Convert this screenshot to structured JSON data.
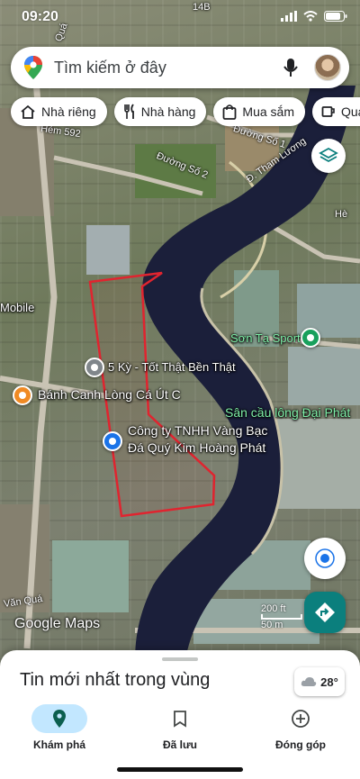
{
  "status_bar": {
    "time": "09:20"
  },
  "search": {
    "placeholder": "Tìm kiếm ở đây"
  },
  "chips": [
    {
      "label": "Nhà riêng",
      "icon": "home-icon"
    },
    {
      "label": "Nhà hàng",
      "icon": "restaurant-icon"
    },
    {
      "label": "Mua sắm",
      "icon": "shopping-bag-icon"
    },
    {
      "label": "Quá",
      "icon": "coffee-icon"
    }
  ],
  "map": {
    "streets": [
      "Hẻm 592",
      "Đường Số 1",
      "Đường Số 2",
      "Đ. Tham Lương",
      "Văn Quá",
      "Quá",
      "Hè",
      "14B"
    ],
    "places": {
      "mobile": "Mobile",
      "son_ta": "Sơn Tạ Sport",
      "ky_tot": "5 Kỳ - Tốt Thật Bền Thật",
      "san_cau_long": "Sân cầu lông Đại Phát",
      "banh_canh": "Bánh Canh Lòng Cá Út C",
      "cong_ty_line1": "Công ty TNHH Vàng Bạc",
      "cong_ty_line2": "Đá Quý Kim Hoàng Phát"
    },
    "google_logo": "Google Maps",
    "scale": {
      "line1": "200 ft",
      "line2": "50 m"
    },
    "colors": {
      "river": "#1b1f3a",
      "boundary": "#e0242f",
      "green_pin": "#18a05c",
      "blue_pin": "#1a73e8",
      "gray_pin": "#80868b",
      "orange_pin": "#f08a24"
    }
  },
  "bottom_sheet": {
    "title": "Tin mới nhất trong vùng",
    "weather": "28°"
  },
  "nav": {
    "explore": "Khám phá",
    "saved": "Đã lưu",
    "contribute": "Đóng góp"
  }
}
